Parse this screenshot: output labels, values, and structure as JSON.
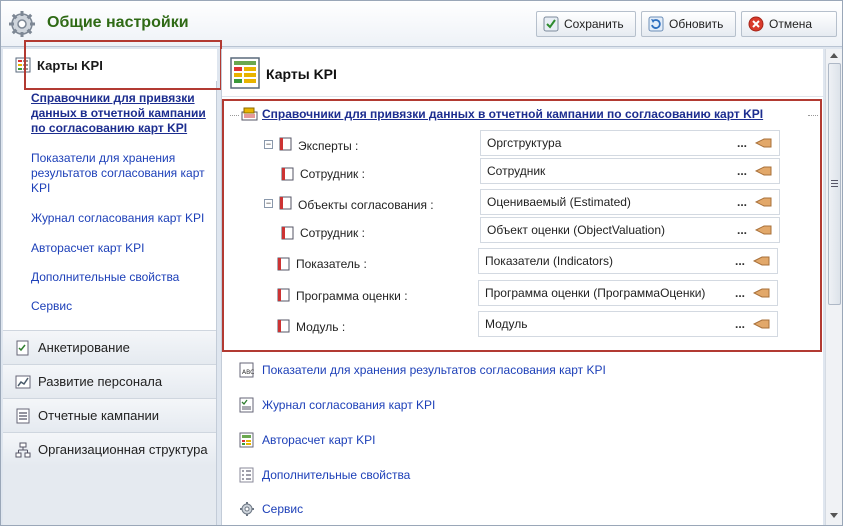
{
  "window": {
    "title": "Общие настройки",
    "title_color": "#2f6a15"
  },
  "toolbar": {
    "save_label": "Сохранить",
    "refresh_label": "Обновить",
    "cancel_label": "Отмена"
  },
  "sidebar": {
    "header": "Карты KPI",
    "links": [
      {
        "label": "Справочники для привязки данных в отчетной кампании по согласованию карт KPI",
        "active": true
      },
      {
        "label": "Показатели для хранения результатов согласования карт KPI",
        "active": false
      },
      {
        "label": "Журнал согласования карт KPI",
        "active": false
      },
      {
        "label": "Авторасчет карт KPI",
        "active": false
      },
      {
        "label": "Дополнительные свойства",
        "active": false
      },
      {
        "label": "Сервис",
        "active": false
      }
    ],
    "sections": [
      {
        "label": "Анкетирование",
        "icon": "checklist-icon"
      },
      {
        "label": "Развитие персонала",
        "icon": "growth-chart-icon"
      },
      {
        "label": "Отчетные кампании",
        "icon": "report-list-icon"
      },
      {
        "label": "Организационная структура",
        "icon": "org-structure-icon"
      }
    ]
  },
  "main": {
    "header": "Карты KPI",
    "section_title": "Справочники для привязки данных в отчетной кампании по согласованию карт KPI",
    "rows": [
      {
        "label": "Эксперты :",
        "value": "Оргструктура",
        "collapsible": true
      },
      {
        "label": "Сотрудник :",
        "value": "Сотрудник",
        "collapsible": false
      },
      {
        "label": "Объекты согласования :",
        "value": "Оцениваемый (Estimated)",
        "collapsible": true
      },
      {
        "label": "Сотрудник :",
        "value": "Объект оценки (ObjectValuation)",
        "collapsible": false
      },
      {
        "label": "Показатель :",
        "value": "Показатели (Indicators)",
        "collapsible": false
      },
      {
        "label": "Программа оценки :",
        "value": "Программа оценки (ПрограммаОценки)",
        "collapsible": false
      },
      {
        "label": "Модуль :",
        "value": "Модуль",
        "collapsible": false
      }
    ],
    "dots_label": "...",
    "links": [
      {
        "label": "Показатели для хранения результатов согласования карт KPI",
        "icon": "abc-sheet-icon"
      },
      {
        "label": "Журнал согласования карт KPI",
        "icon": "journal-icon"
      },
      {
        "label": "Авторасчет карт KPI",
        "icon": "calculator-icon"
      },
      {
        "label": "Дополнительные свойства",
        "icon": "properties-list-icon"
      },
      {
        "label": "Сервис",
        "icon": "gear-icon"
      }
    ]
  },
  "colors": {
    "highlight_border": "#b23a32",
    "link": "#1c3fb8"
  }
}
